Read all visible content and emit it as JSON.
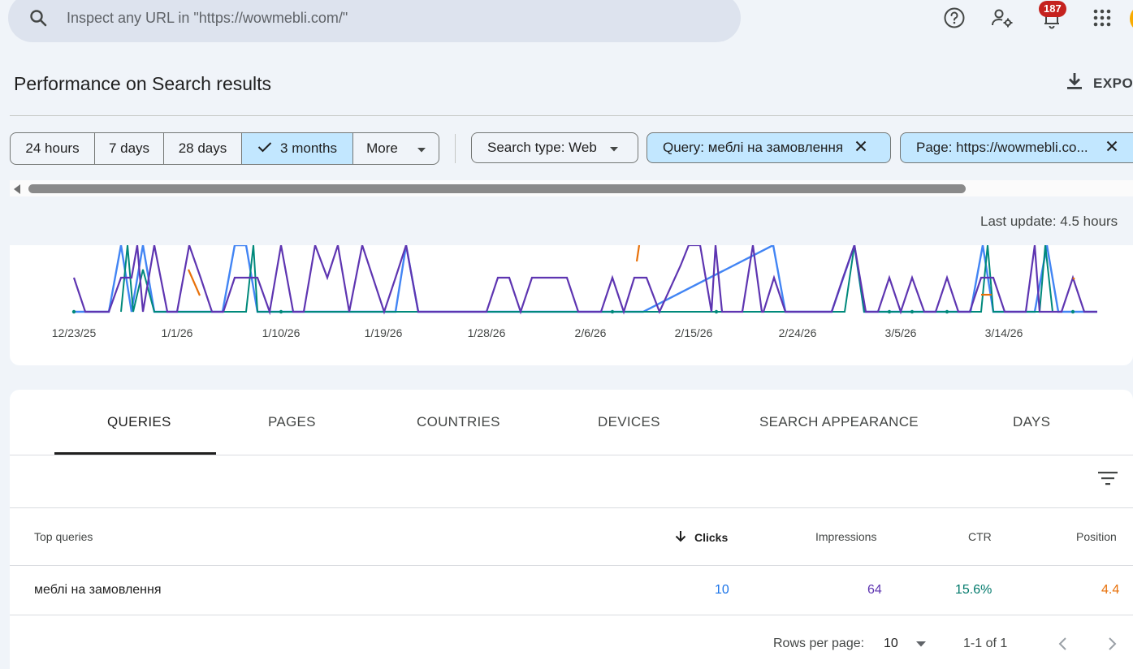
{
  "search": {
    "placeholder": "Inspect any URL in \"https://wowmebli.com/\""
  },
  "header": {
    "notifications_count": "187",
    "icons": [
      "help-icon",
      "manage-users-icon",
      "notifications-icon",
      "apps-grid-icon"
    ]
  },
  "page": {
    "title": "Performance on Search results",
    "export_label": "EXPO",
    "last_update": "Last update: 4.5 hours"
  },
  "date_range": {
    "options": [
      "24 hours",
      "7 days",
      "28 days",
      "3 months",
      "More"
    ],
    "selected": "3 months"
  },
  "filters": {
    "search_type": "Search type: Web",
    "query": "Query: меблі на замовлення",
    "page": "Page: https://wowmebli.co..."
  },
  "chart": {
    "x_ticks": [
      "12/23/25",
      "1/1/26",
      "1/10/26",
      "1/19/26",
      "1/28/26",
      "2/6/26",
      "2/15/26",
      "2/24/26",
      "3/5/26",
      "3/14/26"
    ],
    "colors": {
      "clicks": "#4285f4",
      "impressions": "#5e35b1",
      "ctr": "#00897b",
      "position": "#e8710a"
    }
  },
  "tabs": [
    "QUERIES",
    "PAGES",
    "COUNTRIES",
    "DEVICES",
    "SEARCH APPEARANCE",
    "DAYS"
  ],
  "table": {
    "headers": {
      "query": "Top queries",
      "clicks": "Clicks",
      "impressions": "Impressions",
      "ctr": "CTR",
      "position": "Position"
    },
    "rows": [
      {
        "query": "меблі на замовлення",
        "clicks": "10",
        "impressions": "64",
        "ctr": "15.6%",
        "position": "4.4"
      }
    ]
  },
  "pagination": {
    "rows_per_page_label": "Rows per page:",
    "rows_per_page": "10",
    "range": "1-1 of 1"
  }
}
